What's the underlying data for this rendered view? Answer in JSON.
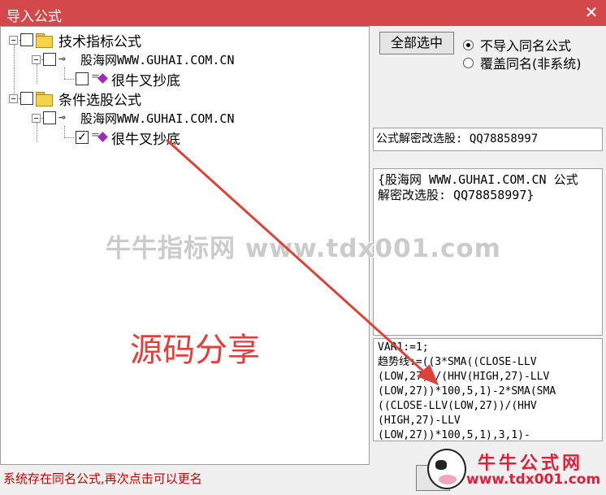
{
  "window": {
    "title": "导入公式",
    "close_glyph": "✕"
  },
  "tree": {
    "groups": [
      {
        "label": "技术指标公式",
        "source": {
          "label": "股海网WWW.GUHAI.COM.CN",
          "formula": {
            "label": "很牛叉抄底",
            "checked": false
          }
        }
      },
      {
        "label": "条件选股公式",
        "source": {
          "label": "股海网WWW.GUHAI.COM.CN",
          "formula": {
            "label": "很牛叉抄底",
            "checked": true
          }
        }
      }
    ]
  },
  "controls": {
    "select_all_label": "全部选中",
    "radio_options": [
      {
        "label": "不导入同名公式",
        "selected": true
      },
      {
        "label": "覆盖同名(非系统)",
        "selected": false
      }
    ]
  },
  "panels": {
    "contact": "公式解密改选股: QQ78858997",
    "description": "{股海网 WWW.GUHAI.COM.CN 公式\n解密改选股: QQ78858997}",
    "source_code": "VAR1:=1;\n趋势线:=((3*SMA((CLOSE-LLV\n(LOW,27))/(HHV(HIGH,27)-LLV\n(LOW,27))*100,5,1)-2*SMA(SMA\n((CLOSE-LLV(LOW,27))/(HHV\n(HIGH,27)-LLV\n(LOW,27))*100,5,1),3,1)-"
  },
  "status": "系统存在同名公式,再次点击可以更名",
  "watermarks": {
    "center": "牛牛指标网 www.tdx001.com",
    "share": "源码分享",
    "logo_title": "牛牛公式网",
    "logo_url": "www.tdx001.com"
  },
  "colors": {
    "titlebar": "#d3484a",
    "status_text": "#cc0000",
    "annotation": "#e0403a",
    "formula_icon": "#9b2fb3"
  },
  "icons": [
    "close-icon",
    "folder-icon",
    "key-icon",
    "formula-icon",
    "cow-logo-icon"
  ]
}
